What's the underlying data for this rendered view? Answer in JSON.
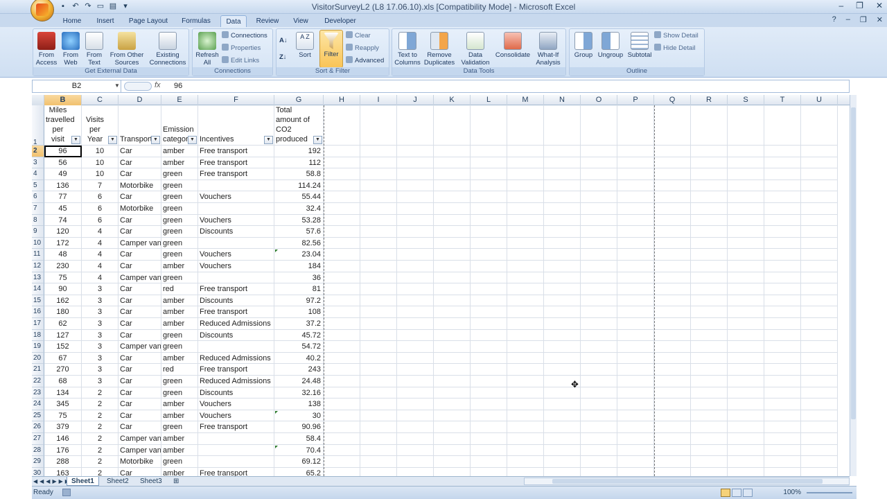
{
  "window": {
    "title": "VisitorSurveyL2 (L8 17.06.10).xls  [Compatibility Mode] - Microsoft Excel"
  },
  "ribbon_tabs": [
    "Home",
    "Insert",
    "Page Layout",
    "Formulas",
    "Data",
    "Review",
    "View",
    "Developer"
  ],
  "active_tab": "Data",
  "ribbon": {
    "get_external_data": {
      "label": "Get External Data",
      "buttons": [
        "From Access",
        "From Web",
        "From Text",
        "From Other Sources",
        "Existing Connections"
      ]
    },
    "connections": {
      "label": "Connections",
      "refresh": "Refresh All",
      "small": [
        "Connections",
        "Properties",
        "Edit Links"
      ]
    },
    "sort_filter": {
      "label": "Sort & Filter",
      "sort": "Sort",
      "filter": "Filter",
      "small": [
        "Clear",
        "Reapply",
        "Advanced"
      ]
    },
    "data_tools": {
      "label": "Data Tools",
      "buttons": [
        "Text to Columns",
        "Remove Duplicates",
        "Data Validation",
        "Consolidate",
        "What-If Analysis"
      ]
    },
    "outline": {
      "label": "Outline",
      "buttons": [
        "Group",
        "Ungroup",
        "Subtotal"
      ],
      "small": [
        "Show Detail",
        "Hide Detail"
      ]
    }
  },
  "formula_bar": {
    "name_box": "B2",
    "fx": "fx",
    "value": "96"
  },
  "columns": [
    "B",
    "C",
    "D",
    "E",
    "F",
    "G",
    "H",
    "I",
    "J",
    "K",
    "L",
    "M",
    "N",
    "O",
    "P",
    "Q",
    "R",
    "S",
    "T",
    "U"
  ],
  "headers": {
    "B": "Miles travelled per visit",
    "C": "Visits per Year",
    "D": "Transport",
    "E": "Emission category",
    "F": "Incentives",
    "G": "Total amount of CO2 produced"
  },
  "header_row_num": "1",
  "rows": [
    {
      "n": "2",
      "b": "96",
      "c": "10",
      "d": "Car",
      "e": "amber",
      "f": "Free transport",
      "g": "192"
    },
    {
      "n": "3",
      "b": "56",
      "c": "10",
      "d": "Car",
      "e": "amber",
      "f": "Free transport",
      "g": "112"
    },
    {
      "n": "4",
      "b": "49",
      "c": "10",
      "d": "Car",
      "e": "green",
      "f": "Free transport",
      "g": "58.8"
    },
    {
      "n": "5",
      "b": "136",
      "c": "7",
      "d": "Motorbike",
      "e": "green",
      "f": "",
      "g": "114.24"
    },
    {
      "n": "6",
      "b": "77",
      "c": "6",
      "d": "Car",
      "e": "green",
      "f": "Vouchers",
      "g": "55.44"
    },
    {
      "n": "7",
      "b": "45",
      "c": "6",
      "d": "Motorbike",
      "e": "green",
      "f": "",
      "g": "32.4"
    },
    {
      "n": "8",
      "b": "74",
      "c": "6",
      "d": "Car",
      "e": "green",
      "f": "Vouchers",
      "g": "53.28"
    },
    {
      "n": "9",
      "b": "120",
      "c": "4",
      "d": "Car",
      "e": "green",
      "f": "Discounts",
      "g": "57.6"
    },
    {
      "n": "10",
      "b": "172",
      "c": "4",
      "d": "Camper van",
      "e": "green",
      "f": "",
      "g": "82.56"
    },
    {
      "n": "11",
      "b": "48",
      "c": "4",
      "d": "Car",
      "e": "green",
      "f": "Vouchers",
      "g": "23.04"
    },
    {
      "n": "12",
      "b": "230",
      "c": "4",
      "d": "Car",
      "e": "amber",
      "f": "Vouchers",
      "g": "184"
    },
    {
      "n": "13",
      "b": "75",
      "c": "4",
      "d": "Camper van",
      "e": "green",
      "f": "",
      "g": "36"
    },
    {
      "n": "14",
      "b": "90",
      "c": "3",
      "d": "Car",
      "e": "red",
      "f": "Free transport",
      "g": "81"
    },
    {
      "n": "15",
      "b": "162",
      "c": "3",
      "d": "Car",
      "e": "amber",
      "f": "Discounts",
      "g": "97.2"
    },
    {
      "n": "16",
      "b": "180",
      "c": "3",
      "d": "Car",
      "e": "amber",
      "f": "Free transport",
      "g": "108"
    },
    {
      "n": "17",
      "b": "62",
      "c": "3",
      "d": "Car",
      "e": "amber",
      "f": "Reduced Admissions",
      "g": "37.2"
    },
    {
      "n": "18",
      "b": "127",
      "c": "3",
      "d": "Car",
      "e": "green",
      "f": "Discounts",
      "g": "45.72"
    },
    {
      "n": "19",
      "b": "152",
      "c": "3",
      "d": "Camper van",
      "e": "green",
      "f": "",
      "g": "54.72"
    },
    {
      "n": "20",
      "b": "67",
      "c": "3",
      "d": "Car",
      "e": "amber",
      "f": "Reduced Admissions",
      "g": "40.2"
    },
    {
      "n": "21",
      "b": "270",
      "c": "3",
      "d": "Car",
      "e": "red",
      "f": "Free transport",
      "g": "243"
    },
    {
      "n": "22",
      "b": "68",
      "c": "3",
      "d": "Car",
      "e": "green",
      "f": "Reduced Admissions",
      "g": "24.48"
    },
    {
      "n": "23",
      "b": "134",
      "c": "2",
      "d": "Car",
      "e": "green",
      "f": "Discounts",
      "g": "32.16"
    },
    {
      "n": "24",
      "b": "345",
      "c": "2",
      "d": "Car",
      "e": "amber",
      "f": "Vouchers",
      "g": "138"
    },
    {
      "n": "25",
      "b": "75",
      "c": "2",
      "d": "Car",
      "e": "amber",
      "f": "Vouchers",
      "g": "30"
    },
    {
      "n": "26",
      "b": "379",
      "c": "2",
      "d": "Car",
      "e": "green",
      "f": "Free transport",
      "g": "90.96"
    },
    {
      "n": "27",
      "b": "146",
      "c": "2",
      "d": "Camper van",
      "e": "amber",
      "f": "",
      "g": "58.4"
    },
    {
      "n": "28",
      "b": "176",
      "c": "2",
      "d": "Camper van",
      "e": "amber",
      "f": "",
      "g": "70.4"
    },
    {
      "n": "29",
      "b": "288",
      "c": "2",
      "d": "Motorbike",
      "e": "green",
      "f": "",
      "g": "69.12"
    },
    {
      "n": "30",
      "b": "163",
      "c": "2",
      "d": "Car",
      "e": "amber",
      "f": "Free transport",
      "g": "65.2"
    }
  ],
  "sheets": [
    "Sheet1",
    "Sheet2",
    "Sheet3"
  ],
  "active_sheet": "Sheet1",
  "status": {
    "ready": "Ready",
    "zoom": "100%"
  },
  "colors": {
    "accent": "#f9c457",
    "ribbon": "#cfdff2",
    "selected_header": "#f1c16e"
  }
}
